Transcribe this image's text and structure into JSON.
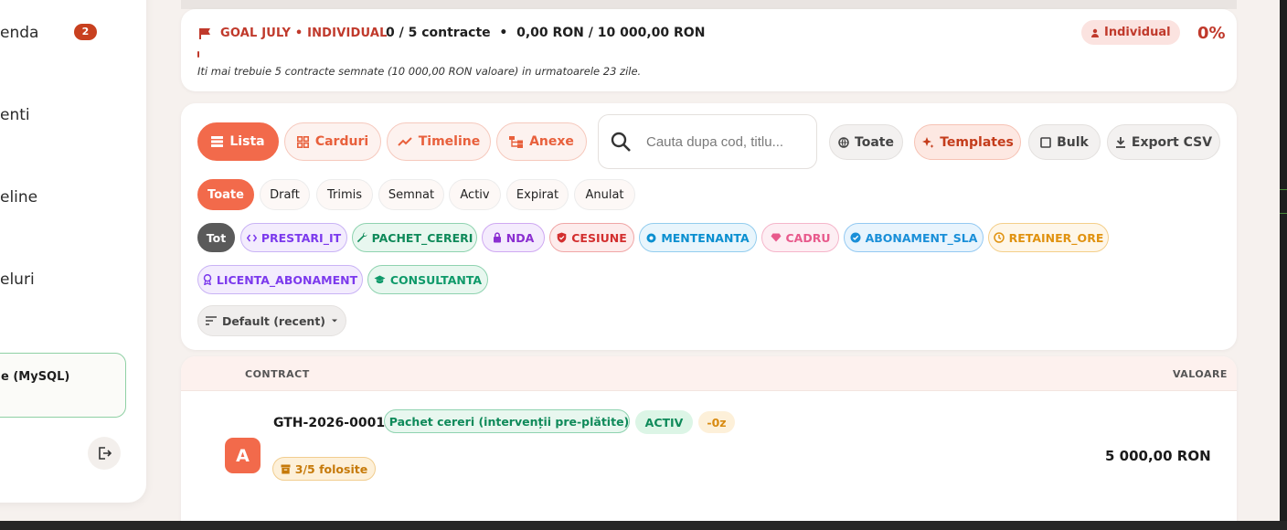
{
  "sidebar": {
    "items": [
      {
        "label": "enda"
      },
      {
        "label": "enti"
      },
      {
        "label": "eline"
      },
      {
        "label": "eluri"
      }
    ],
    "badge": "2",
    "db_label": "e (MySQL)"
  },
  "goal": {
    "title": "GOAL JULY • INDIVIDUAL",
    "progress": "0 / 5 contracte  •  0,00 RON / 10 000,00 RON",
    "scope_label": "Individual",
    "percent": "0%",
    "progress_fraction": 0.0,
    "note": "Iti mai trebuie 5 contracte semnate (10 000,00 RON valoare) in urmatoarele 23 zile."
  },
  "toolbar": {
    "views": [
      {
        "label": "Lista",
        "icon": "list-icon",
        "active": true
      },
      {
        "label": "Carduri",
        "icon": "grid-icon",
        "active": false
      },
      {
        "label": "Timeline",
        "icon": "trend-icon",
        "active": false
      },
      {
        "label": "Anexe",
        "icon": "tree-icon",
        "active": false
      }
    ],
    "search_placeholder": "Cauta dupa cod, titlu...",
    "scope_label": "Toate",
    "templates_label": "Templates",
    "bulk_label": "Bulk",
    "export_label": "Export CSV"
  },
  "statuses": [
    "Toate",
    "Draft",
    "Trimis",
    "Semnat",
    "Activ",
    "Expirat",
    "Anulat"
  ],
  "types": [
    {
      "label": "Tot",
      "icon": "",
      "color": "#555555"
    },
    {
      "label": "PRESTARI_IT",
      "icon": "code-icon",
      "color": "#7c3aed"
    },
    {
      "label": "PACHET_CERERI",
      "icon": "wrench-icon",
      "color": "#0f8a5a"
    },
    {
      "label": "NDA",
      "icon": "lock-icon",
      "color": "#8b2fd1"
    },
    {
      "label": "CESIUNE",
      "icon": "shield-icon",
      "color": "#d32f2f"
    },
    {
      "label": "MENTENANTA",
      "icon": "support-icon",
      "color": "#0a8fd0"
    },
    {
      "label": "CADRU",
      "icon": "diamond-icon",
      "color": "#e85a8c"
    },
    {
      "label": "ABONAMENT_SLA",
      "icon": "verified-icon",
      "color": "#1a8fd8"
    },
    {
      "label": "RETAINER_ORE",
      "icon": "clock-icon",
      "color": "#e09210"
    },
    {
      "label": "LICENTA_ABONAMENT",
      "icon": "badge-icon",
      "color": "#7c3aed"
    },
    {
      "label": "CONSULTANTA",
      "icon": "graduation-icon",
      "color": "#0f9a6a"
    }
  ],
  "sort_label": "Default (recent)",
  "table": {
    "headers": [
      "CONTRACT",
      "VALOARE"
    ],
    "rows": [
      {
        "avatar": "A",
        "code": "GTH-2026-0001",
        "type_label": "Pachet cereri (intervenții pre-plătite)",
        "status": "ACTIV",
        "days": "-0z",
        "usage": "3/5 folosite",
        "value": "5 000,00 RON"
      }
    ]
  }
}
